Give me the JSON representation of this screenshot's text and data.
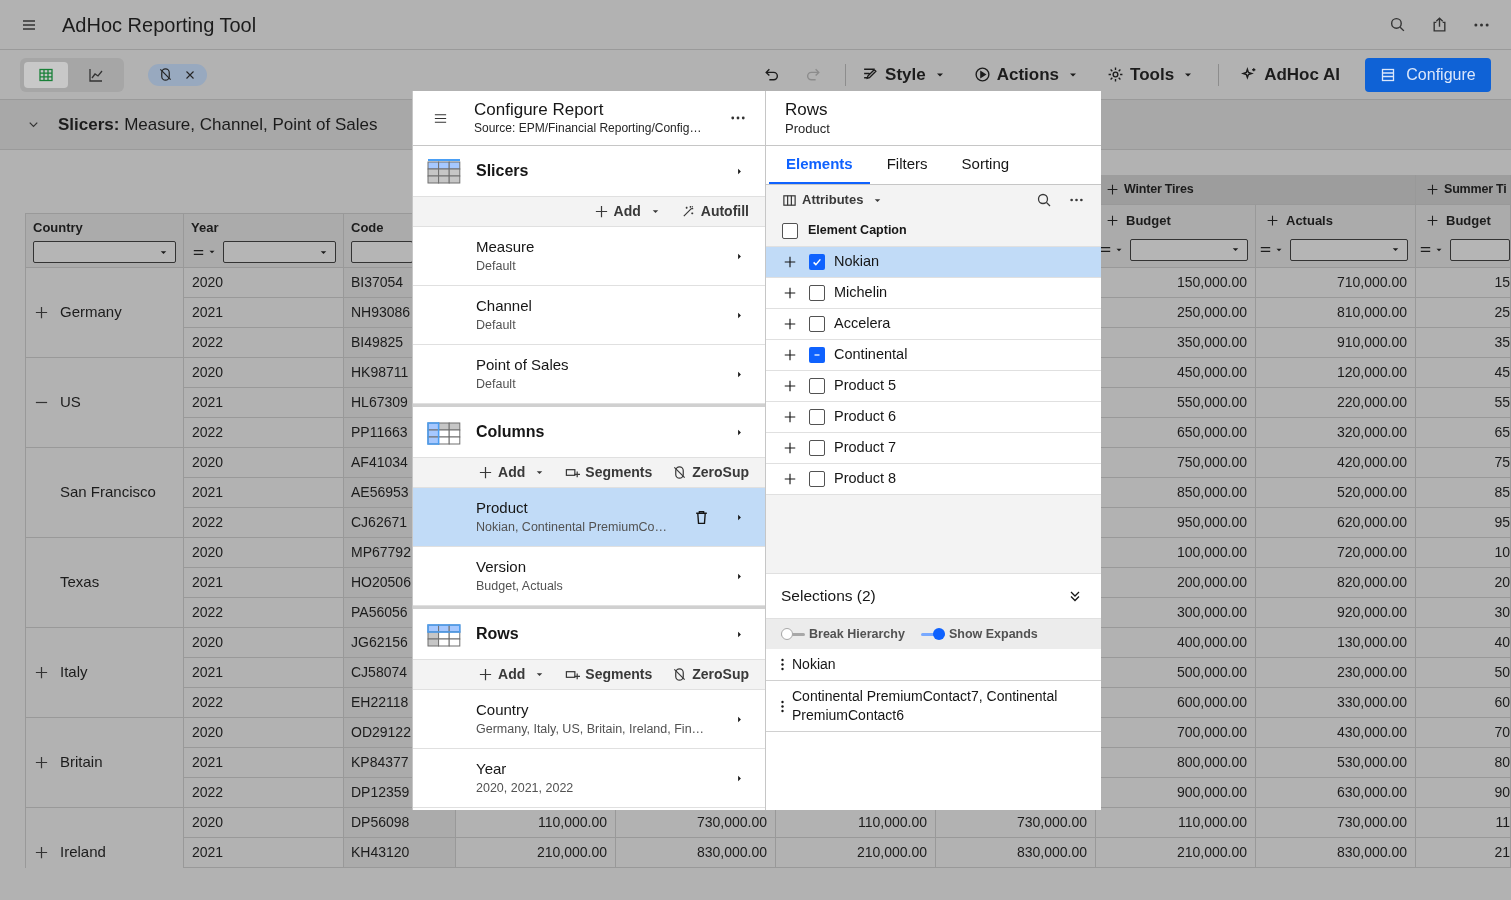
{
  "app_bar": {
    "title": "AdHoc Reporting Tool",
    "actions": [
      {
        "kind": "search"
      },
      {
        "kind": "share"
      },
      {
        "kind": "more"
      }
    ]
  },
  "toolbar": {
    "views": [
      {
        "kind": "grid",
        "selected": true
      },
      {
        "kind": "chart",
        "selected": false
      }
    ],
    "chip": {
      "removable": true
    },
    "history": [
      {
        "kind": "undo",
        "disabled": false
      },
      {
        "kind": "redo",
        "disabled": true
      }
    ],
    "menus": [
      {
        "kind": "style",
        "label": "Style",
        "has_menu": true
      },
      {
        "kind": "actions",
        "label": "Actions",
        "has_menu": true
      },
      {
        "kind": "tools",
        "label": "Tools",
        "has_menu": true
      }
    ],
    "ai_button": {
      "label": "AdHoc AI"
    },
    "configure_button": {
      "label": "Configure"
    }
  },
  "slicer_bar": {
    "expanded": true,
    "text": "**Slicers:** Measure, Channel, Point of Sales"
  },
  "table": {
    "columns": [
      {
        "label": "Country",
        "has_operator": false
      },
      {
        "label": "Year",
        "has_operator": true
      },
      {
        "label": "Code",
        "has_operator": false
      }
    ],
    "value_groups": [
      {
        "label": "Winter Tires",
        "columns": [
          {
            "label": "Budget"
          },
          {
            "label": "Actuals"
          }
        ]
      },
      {
        "label": "Summer Ti",
        "columns": [
          {
            "label": "Budget"
          }
        ]
      }
    ],
    "groups": [
      {
        "country": "Germany",
        "expanded": false,
        "rows": [
          {
            "year": "2020",
            "code": "BI37054",
            "values": [
              "150,000.00",
              "710,000.00",
              "15"
            ]
          },
          {
            "year": "2021",
            "code": "NH93086",
            "values": [
              "250,000.00",
              "810,000.00",
              "25"
            ]
          },
          {
            "year": "2022",
            "code": "BI49825",
            "values": [
              "350,000.00",
              "910,000.00",
              "35"
            ]
          }
        ]
      },
      {
        "country": "US",
        "expanded": true,
        "rows": [
          {
            "year": "2020",
            "code": "HK98711",
            "values": [
              "450,000.00",
              "120,000.00",
              "45"
            ]
          },
          {
            "year": "2021",
            "code": "HL67309",
            "values": [
              "550,000.00",
              "220,000.00",
              "55"
            ]
          },
          {
            "year": "2022",
            "code": "PP11663",
            "values": [
              "650,000.00",
              "320,000.00",
              "65"
            ]
          }
        ],
        "children": [
          {
            "country": "San Francisco",
            "rows": [
              {
                "year": "2020",
                "code": "AF41034",
                "values": [
                  "750,000.00",
                  "420,000.00",
                  "75"
                ]
              },
              {
                "year": "2021",
                "code": "AE56953",
                "values": [
                  "850,000.00",
                  "520,000.00",
                  "85"
                ]
              },
              {
                "year": "2022",
                "code": "CJ62671",
                "values": [
                  "950,000.00",
                  "620,000.00",
                  "95"
                ]
              }
            ]
          },
          {
            "country": "Texas",
            "rows": [
              {
                "year": "2020",
                "code": "MP67792",
                "values": [
                  "100,000.00",
                  "720,000.00",
                  "10"
                ]
              },
              {
                "year": "2021",
                "code": "HO20506",
                "values": [
                  "200,000.00",
                  "820,000.00",
                  "20"
                ]
              },
              {
                "year": "2022",
                "code": "PA56056",
                "values": [
                  "300,000.00",
                  "920,000.00",
                  "30"
                ]
              }
            ]
          }
        ]
      },
      {
        "country": "Italy",
        "expanded": false,
        "rows": [
          {
            "year": "2020",
            "code": "JG62156",
            "values": [
              "400,000.00",
              "130,000.00",
              "40"
            ]
          },
          {
            "year": "2021",
            "code": "CJ58074",
            "values": [
              "500,000.00",
              "230,000.00",
              "50"
            ]
          },
          {
            "year": "2022",
            "code": "EH22118",
            "values": [
              "600,000.00",
              "330,000.00",
              "60"
            ]
          }
        ]
      },
      {
        "country": "Britain",
        "expanded": false,
        "rows": [
          {
            "year": "2020",
            "code": "OD29122",
            "values": [
              "700,000.00",
              "430,000.00",
              "70"
            ]
          },
          {
            "year": "2021",
            "code": "KP84377",
            "values": [
              "800,000.00",
              "530,000.00",
              "80"
            ]
          },
          {
            "year": "2022",
            "code": "DP12359",
            "values": [
              "900,000.00",
              "630,000.00",
              "90"
            ]
          }
        ]
      },
      {
        "country": "Ireland",
        "expanded": false,
        "rows": [
          {
            "year": "2020",
            "code": "DP56098",
            "values": [
              "110,000.00",
              "730,000.00",
              "110,000.00",
              "730,000.00",
              "110,000.00",
              "730,000.00",
              "11"
            ]
          },
          {
            "year": "2021",
            "code": "KH43120",
            "values": [
              "210,000.00",
              "830,000.00",
              "210,000.00",
              "830,000.00",
              "210,000.00",
              "830,000.00",
              "21"
            ]
          }
        ]
      }
    ]
  },
  "config_panel": {
    "title": "Configure Report",
    "source": "Source: EPM/Financial Reporting/Config…",
    "sections": [
      {
        "kind": "slicers",
        "title": "Slicers",
        "actions": [
          {
            "kind": "add",
            "label": "Add"
          },
          {
            "kind": "autofill",
            "label": "Autofill"
          }
        ],
        "items": [
          {
            "name": "Measure",
            "value": "Default",
            "selected": false
          },
          {
            "name": "Channel",
            "value": "Default",
            "selected": false
          },
          {
            "name": "Point of Sales",
            "value": "Default",
            "selected": false
          }
        ]
      },
      {
        "kind": "columns",
        "title": "Columns",
        "actions": [
          {
            "kind": "add",
            "label": "Add"
          },
          {
            "kind": "segments",
            "label": "Segments"
          },
          {
            "kind": "zerosup",
            "label": "ZeroSup"
          }
        ],
        "items": [
          {
            "name": "Product",
            "value": "Nokian, Continental PremiumCo…",
            "selected": true
          },
          {
            "name": "Version",
            "value": "Budget, Actuals",
            "selected": false
          }
        ]
      },
      {
        "kind": "rows",
        "title": "Rows",
        "actions": [
          {
            "kind": "add",
            "label": "Add"
          },
          {
            "kind": "segments",
            "label": "Segments"
          },
          {
            "kind": "zerosup",
            "label": "ZeroSup"
          }
        ],
        "items": [
          {
            "name": "Country",
            "value": "Germany, Italy, US, Britain, Ireland, Fin…",
            "selected": false
          },
          {
            "name": "Year",
            "value": "2020, 2021, 2022",
            "selected": false
          }
        ]
      }
    ]
  },
  "rows_panel": {
    "title": "Rows",
    "subtitle": "Product",
    "tabs": [
      {
        "label": "Elements",
        "selected": true
      },
      {
        "label": "Filters",
        "selected": false
      },
      {
        "label": "Sorting",
        "selected": false
      }
    ],
    "attributes_button": {
      "label": "Attributes"
    },
    "caption_header": {
      "label": "Element Caption",
      "checked": false,
      "partial": false
    },
    "elements": [
      {
        "label": "Nokian",
        "checked": true,
        "partial": false,
        "selected": true
      },
      {
        "label": "Michelin",
        "checked": false,
        "partial": false,
        "selected": false
      },
      {
        "label": "Accelera",
        "checked": false,
        "partial": false,
        "selected": false
      },
      {
        "label": "Continental",
        "checked": true,
        "partial": true,
        "selected": false
      },
      {
        "label": "Product 5",
        "checked": false,
        "partial": false,
        "selected": false
      },
      {
        "label": "Product 6",
        "checked": false,
        "partial": false,
        "selected": false
      },
      {
        "label": "Product 7",
        "checked": false,
        "partial": false,
        "selected": false
      },
      {
        "label": "Product 8",
        "checked": false,
        "partial": false,
        "selected": false
      }
    ],
    "selections": {
      "title": "Selections (2)",
      "toggles": [
        {
          "label": "Break Hierarchy",
          "on": false
        },
        {
          "label": "Show Expands",
          "on": true
        }
      ],
      "items": [
        "Nokian",
        "Continental PremiumContact7, Continental PremiumContact6"
      ]
    }
  }
}
